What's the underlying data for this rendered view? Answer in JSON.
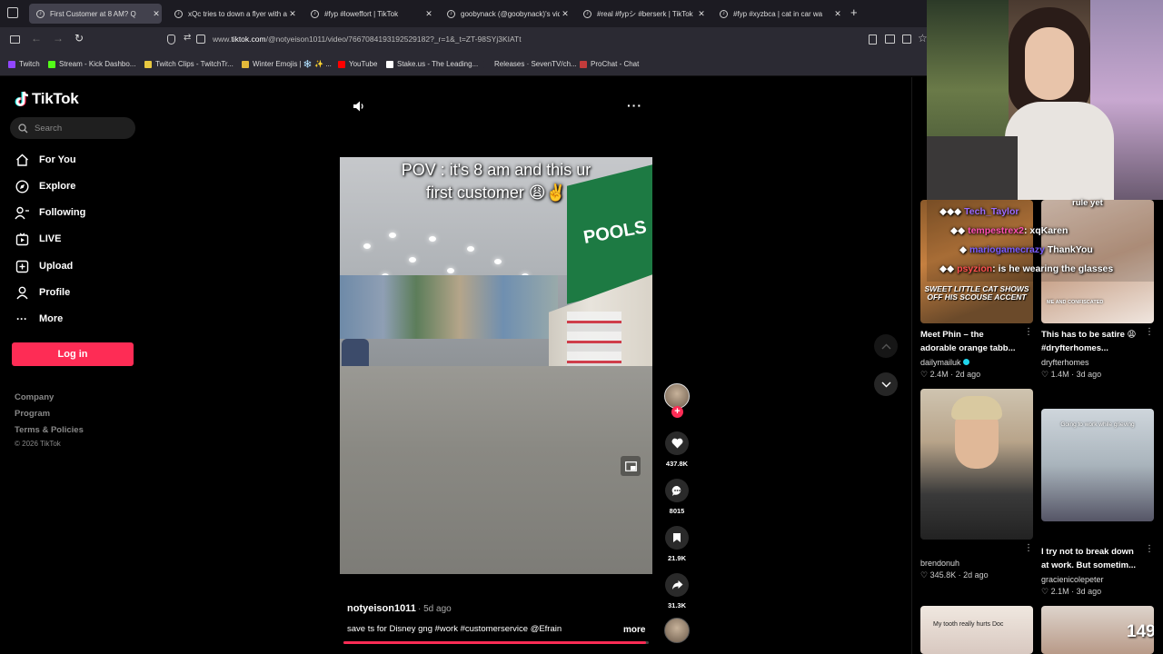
{
  "browser": {
    "tabs": [
      {
        "title": "First Customer at 8 AM? Q",
        "active": true
      },
      {
        "title": "xQc tries to down a flyer with a"
      },
      {
        "title": "#fyp #loweffort | TikTok"
      },
      {
        "title": "goobynack (@goobynack)'s vid"
      },
      {
        "title": "#real #fypシ #berserk | TikTok"
      },
      {
        "title": "#fyp #xyzbca | cat in car wa"
      }
    ],
    "new_tab": "+",
    "url_prefix": "www.",
    "url_domain": "tiktok.com",
    "url_path": "/@notyeison1011/video/7667084193192529182?_r=1&_t=ZT-98SYj3KIATt",
    "bookmarks": [
      "Twitch",
      "Stream - Kick Dashbo...",
      "Twitch Clips - TwitchTr...",
      "Winter Emojis | ❄️ ✨ ...",
      "YouTube",
      "Stake.us - The Leading...",
      "Releases · SevenTV/ch...",
      "ProChat - Chat"
    ]
  },
  "sidebar": {
    "logo": "TikTok",
    "search_placeholder": "Search",
    "items": [
      {
        "label": "For You"
      },
      {
        "label": "Explore"
      },
      {
        "label": "Following"
      },
      {
        "label": "LIVE"
      },
      {
        "label": "Upload"
      },
      {
        "label": "Profile"
      },
      {
        "label": "More"
      }
    ],
    "login": "Log in",
    "footer": [
      "Company",
      "Program",
      "Terms & Policies",
      "© 2026 TikTok"
    ]
  },
  "video": {
    "caption_line1": "POV : it's 8 am and this ur",
    "caption_line2": "first customer 😩✌️",
    "store_sign": "POOLS",
    "author": "notyeison1011",
    "time": "· 5d ago",
    "description": "save ts for Disney gng #work #customerservice @Efrain",
    "more": "more",
    "progress": 0.99
  },
  "actions": {
    "likes": "437.8K",
    "comments": "8015",
    "saves": "21.9K",
    "shares": "31.3K"
  },
  "related": [
    {
      "title": "Meet Phin – the adorable orange tabb...",
      "author": "dailymailuk",
      "likes": "2.4M",
      "age": "2d ago",
      "overlay": "SWEET LITTLE CAT SHOWS OFF HIS SCOUSE ACCENT"
    },
    {
      "title": "This has to be satire 😩 #dryfterhomes...",
      "author": "dryfterhomes",
      "likes": "1.4M",
      "age": "3d ago",
      "overlay": "ME AND CONFISCATED"
    },
    {
      "title": "",
      "author": "brendonuh",
      "likes": "345.8K",
      "age": "2d ago"
    },
    {
      "title": "I try not to break down at work. But sometim...",
      "author": "gracienicolepeter",
      "likes": "2.1M",
      "age": "3d ago",
      "overlay": "Going to work while grieving"
    },
    {
      "title": "",
      "overlay": "My tooth really hurts Doc"
    },
    {
      "title": "",
      "overlay": "149"
    }
  ],
  "chat": [
    {
      "name": "Tech_Taylor",
      "msg": ""
    },
    {
      "name": "tempestrex2",
      "msg": "xqKaren"
    },
    {
      "name": "mariogamecrazy",
      "msg": "ThankYou"
    },
    {
      "name": "psyzion",
      "msg": "is he wearing the glasses"
    }
  ],
  "chat_top": "rule yet",
  "colors": {
    "accent": "#fe2c55",
    "bg": "#000000",
    "chrome": "#2b2a33"
  }
}
